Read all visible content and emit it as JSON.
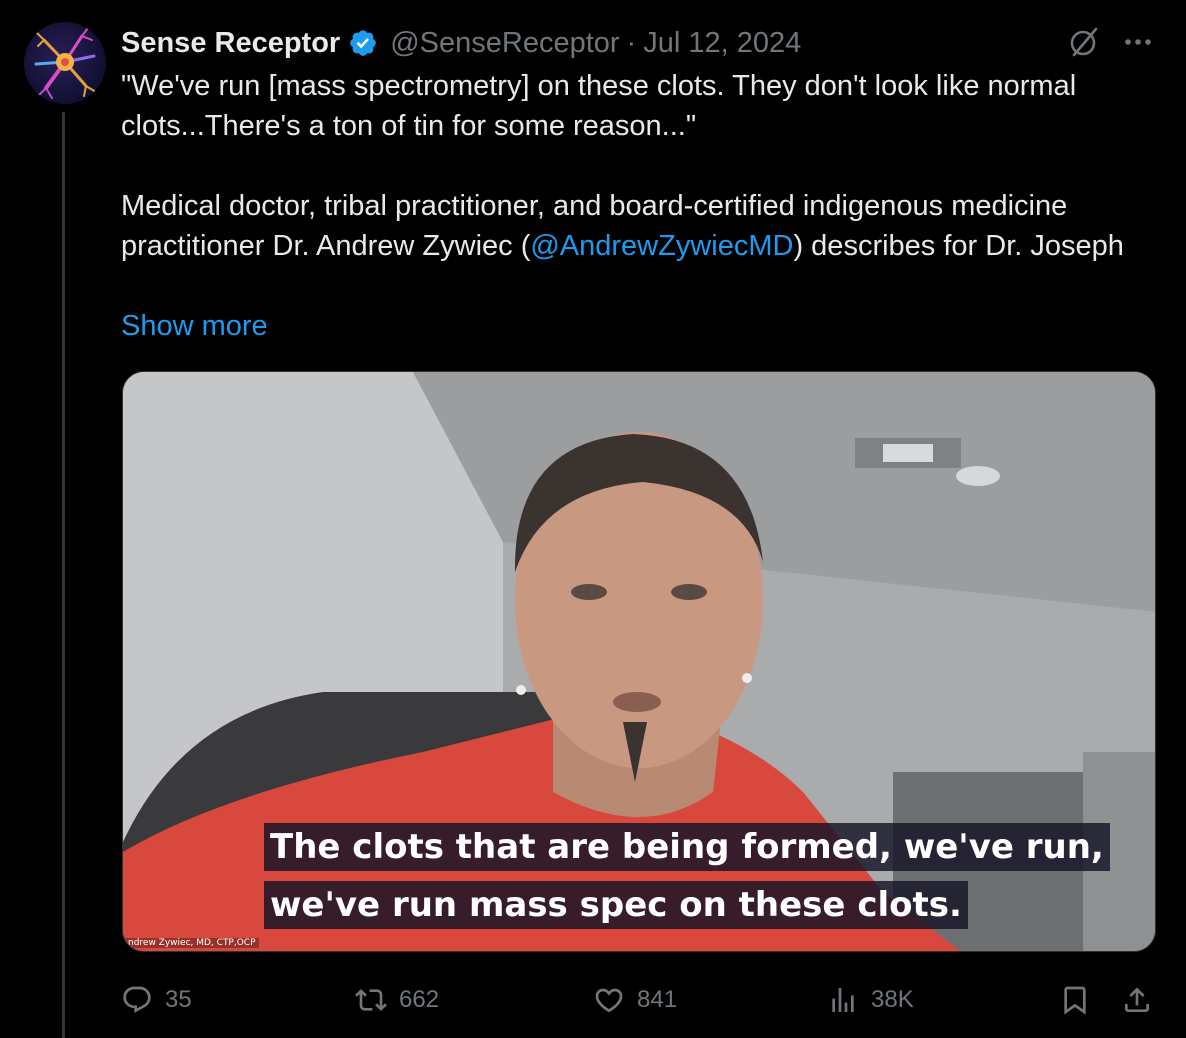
{
  "author": {
    "name": "Sense Receptor",
    "handle": "@SenseReceptor",
    "separator": "·",
    "date": "Jul 12, 2024",
    "avatar_icon": "neuron-logo-icon",
    "verified": true
  },
  "tweet": {
    "line1": "\"We've run [mass spectrometry] on these clots. They don't look like normal clots...There's a ton of tin for some reason...\"",
    "body_before_mention": "Medical doctor, tribal practitioner, and board-certified indigenous medicine practitioner Dr. Andrew Zywiec (",
    "mention": "@AndrewZywiecMD",
    "body_after_mention": ") describes for Dr. Joseph",
    "show_more": "Show more"
  },
  "media": {
    "caption_line1": "The clots that are being formed, we've run,",
    "caption_line2": "we've run mass spec on these clots.",
    "nameplate": "ndrew Zywiec, MD, CTP,OCP"
  },
  "actions": {
    "replies": "35",
    "reposts": "662",
    "likes": "841",
    "views": "38K"
  },
  "colors": {
    "background": "#000000",
    "text": "#e7e9ea",
    "muted": "#71767b",
    "link": "#1d9bf0",
    "verified": "#1d9bf0"
  }
}
